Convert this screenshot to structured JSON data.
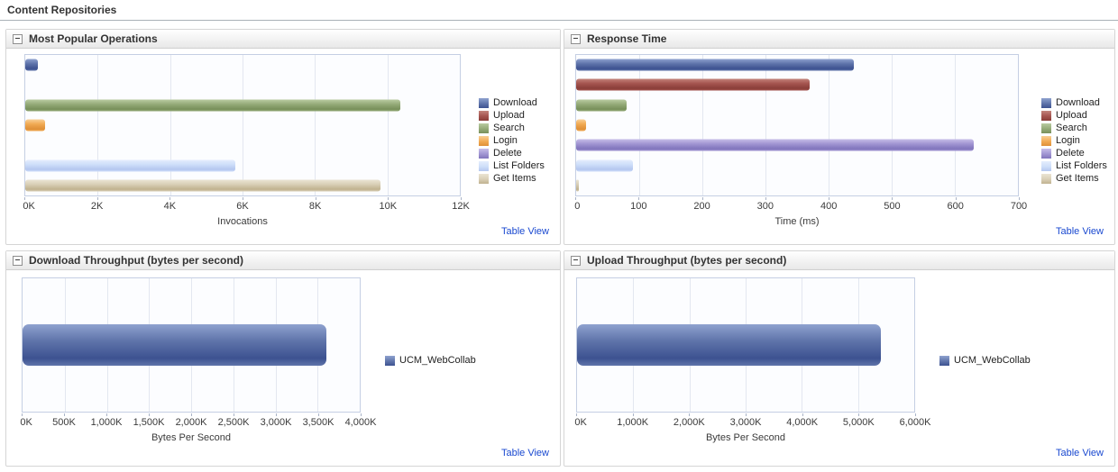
{
  "page": {
    "title": "Content Repositories"
  },
  "icons": {
    "panel_collapse": "minus-box"
  },
  "colors": {
    "link": "#1a49d0",
    "blue": {
      "light": "#8fa2cf",
      "base": "#5f74aa",
      "dark": "#3d5291"
    },
    "red": {
      "light": "#c3847c",
      "base": "#a5544f",
      "dark": "#8a3e39"
    },
    "green": {
      "light": "#b9cba1",
      "base": "#95ab78",
      "dark": "#78905b"
    },
    "orange": {
      "light": "#f9d097",
      "base": "#f1aa53",
      "dark": "#df9038"
    },
    "purple": {
      "light": "#c6bde8",
      "base": "#a195d2",
      "dark": "#8175bc"
    },
    "lightblue": {
      "light": "#e4edfd",
      "base": "#cedef9",
      "dark": "#b4c7ef"
    },
    "tan": {
      "light": "#eae4d4",
      "base": "#d9cfb6",
      "dark": "#c0b28f"
    }
  },
  "panels": [
    {
      "title": "Most Popular Operations",
      "table_view": "Table View"
    },
    {
      "title": "Response Time",
      "table_view": "Table View"
    },
    {
      "title": "Download Throughput (bytes per second)",
      "table_view": "Table View"
    },
    {
      "title": "Upload Throughput (bytes per second)",
      "table_view": "Table View"
    }
  ],
  "chart_data": [
    {
      "type": "bar",
      "orientation": "horizontal",
      "title": "Most Popular Operations",
      "categories": [
        "Download",
        "Upload",
        "Search",
        "Login",
        "Delete",
        "List Folders",
        "Get Items"
      ],
      "values": [
        350,
        0,
        10350,
        550,
        0,
        5800,
        9800
      ],
      "colors": [
        "blue",
        "red",
        "green",
        "orange",
        "purple",
        "lightblue",
        "tan"
      ],
      "xlabel": "Invocations",
      "xlim": [
        0,
        12000
      ],
      "tick_labels": [
        "0K",
        "2K",
        "4K",
        "6K",
        "8K",
        "10K",
        "12K"
      ],
      "grid": true,
      "legend_position": "right"
    },
    {
      "type": "bar",
      "orientation": "horizontal",
      "title": "Response Time",
      "categories": [
        "Download",
        "Upload",
        "Search",
        "Login",
        "Delete",
        "List Folders",
        "Get Items"
      ],
      "values": [
        440,
        370,
        80,
        15,
        630,
        90,
        5
      ],
      "colors": [
        "blue",
        "red",
        "green",
        "orange",
        "purple",
        "lightblue",
        "tan"
      ],
      "xlabel": "Time (ms)",
      "xlim": [
        0,
        700
      ],
      "tick_labels": [
        "0",
        "100",
        "200",
        "300",
        "400",
        "500",
        "600",
        "700"
      ],
      "grid": true,
      "legend_position": "right"
    },
    {
      "type": "bar",
      "orientation": "horizontal",
      "title": "Download Throughput (bytes per second)",
      "categories": [
        "UCM_WebCollab"
      ],
      "values": [
        3600000
      ],
      "colors": [
        "blue"
      ],
      "xlabel": "Bytes Per Second",
      "xlim": [
        0,
        4000000
      ],
      "tick_labels": [
        "0K",
        "500K",
        "1,000K",
        "1,500K",
        "2,000K",
        "2,500K",
        "3,000K",
        "3,500K",
        "4,000K"
      ],
      "grid": true,
      "legend_position": "right"
    },
    {
      "type": "bar",
      "orientation": "horizontal",
      "title": "Upload Throughput (bytes per second)",
      "categories": [
        "UCM_WebCollab"
      ],
      "values": [
        5400000
      ],
      "colors": [
        "blue"
      ],
      "xlabel": "Bytes Per Second",
      "xlim": [
        0,
        6000000
      ],
      "tick_labels": [
        "0K",
        "1,000K",
        "2,000K",
        "3,000K",
        "4,000K",
        "5,000K",
        "6,000K"
      ],
      "grid": true,
      "legend_position": "right"
    }
  ]
}
